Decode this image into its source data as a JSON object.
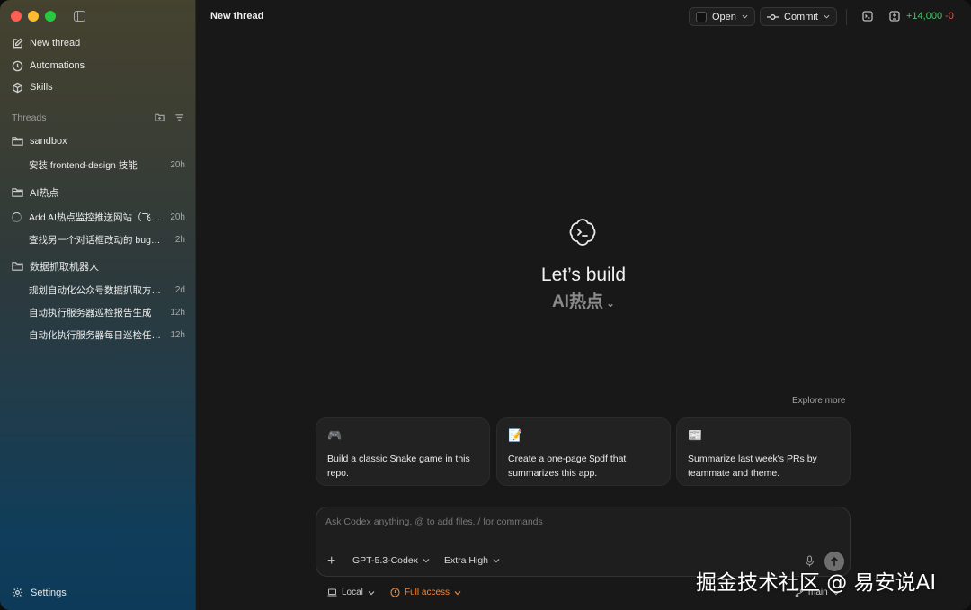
{
  "window": {
    "traffic_colors": [
      "#ff5f57",
      "#febc2e",
      "#28c840"
    ]
  },
  "sidebar": {
    "nav": [
      {
        "label": "New thread",
        "icon": "edit-icon"
      },
      {
        "label": "Automations",
        "icon": "clock-icon"
      },
      {
        "label": "Skills",
        "icon": "cube-icon"
      }
    ],
    "threads_label": "Threads",
    "folders": [
      {
        "name": "sandbox",
        "threads": [
          {
            "title": "安装 frontend-design 技能",
            "time": "20h"
          }
        ]
      },
      {
        "name": "AI热点",
        "threads": [
          {
            "title": "Add AI热点监控推送网站（飞…",
            "time": "20h",
            "loading": true
          },
          {
            "title": "查找另一个对话框改动的 bug…",
            "time": "2h"
          }
        ]
      },
      {
        "name": "数据抓取机器人",
        "threads": [
          {
            "title": "规划自动化公众号数据抓取方…",
            "time": "2d"
          },
          {
            "title": "自动执行服务器巡检报告生成",
            "time": "12h"
          },
          {
            "title": "自动化执行服务器每日巡检任…",
            "time": "12h"
          }
        ]
      }
    ],
    "settings_label": "Settings"
  },
  "header": {
    "title": "New thread",
    "open_label": "Open",
    "commit_label": "Commit",
    "diff_plus": "+14,000",
    "diff_minus": "-0"
  },
  "hero": {
    "title": "Let’s build",
    "project": "AI热点"
  },
  "explore_label": "Explore more",
  "cards": [
    {
      "icon": "gamepad-icon",
      "glyph": "🎮",
      "text": "Build a classic Snake game in this repo."
    },
    {
      "icon": "document-icon",
      "glyph": "📝",
      "text": "Create a one-page $pdf that summarizes this app."
    },
    {
      "icon": "newspaper-icon",
      "glyph": "📰",
      "text": "Summarize last week's PRs by teammate and theme."
    }
  ],
  "composer": {
    "placeholder": "Ask Codex anything, @ to add files, / for commands",
    "model": "GPT-5.3-Codex",
    "effort": "Extra High"
  },
  "footer": {
    "env": "Local",
    "access": "Full access",
    "branch": "main"
  },
  "colors": {
    "accent_warn": "#f0893b",
    "diff_plus": "#4cc26a",
    "diff_minus": "#e5534b"
  },
  "watermark": "掘金技术社区 @ 易安说AI"
}
